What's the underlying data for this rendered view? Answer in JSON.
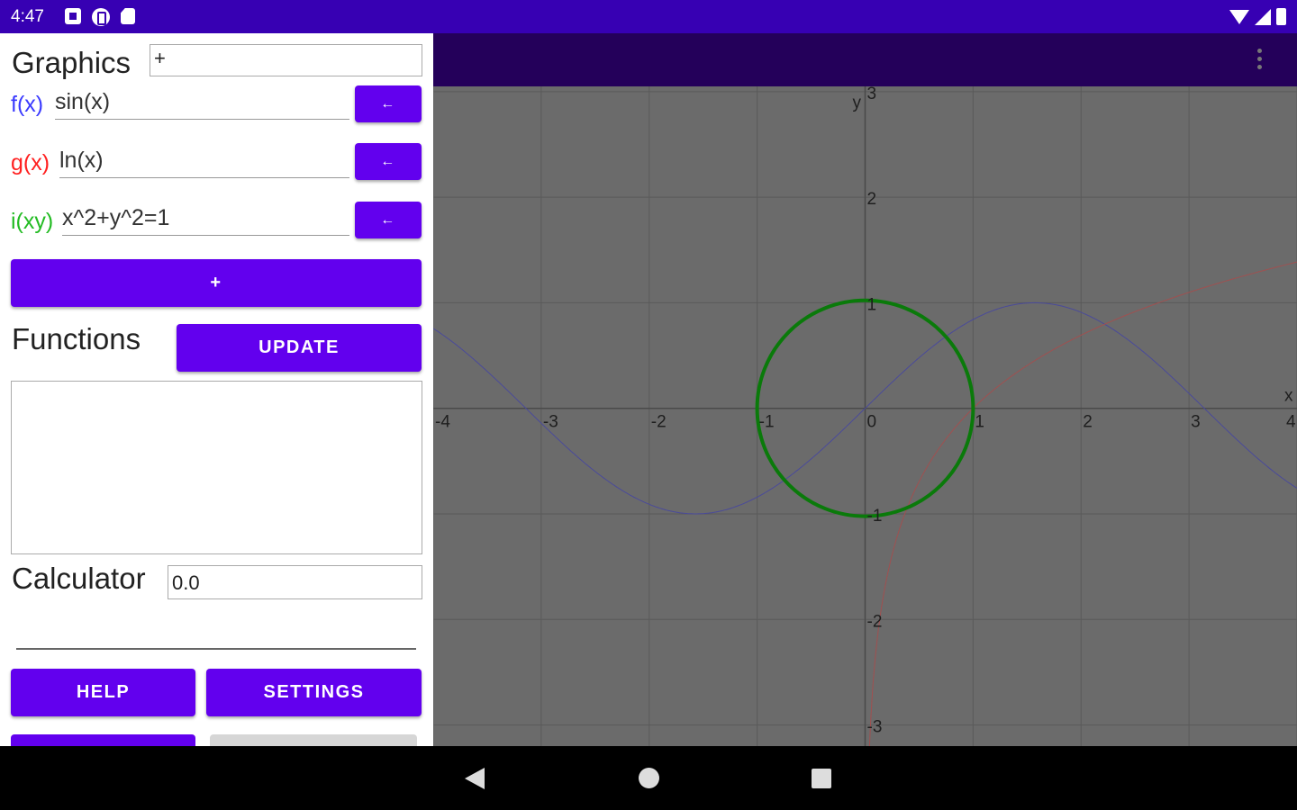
{
  "status_bar": {
    "time": "4:47"
  },
  "panel": {
    "graphics_label": "Graphics",
    "graphics_input_value": "+",
    "functions": [
      {
        "name": "f(x)",
        "expr": "sin(x)",
        "color": "#3b3bff",
        "button": "←"
      },
      {
        "name": "g(x)",
        "expr": "ln(x)",
        "color": "#ff2020",
        "button": "←"
      },
      {
        "name": "i(xy)",
        "expr": "x^2+y^2=1",
        "color": "#22bb22",
        "button": "←"
      }
    ],
    "add_button": "+",
    "functions_label": "Functions",
    "update_button": "UPDATE",
    "calculator_label": "Calculator",
    "calculator_value": "0.0",
    "help_button": "HELP",
    "settings_button": "SETTINGS"
  },
  "graph": {
    "x_axis_label": "x",
    "y_axis_label": "y",
    "x_ticks": [
      "-4",
      "-3",
      "-2",
      "-1",
      "0",
      "1",
      "2",
      "3",
      "4"
    ],
    "y_ticks": [
      "3",
      "2",
      "1",
      "-1",
      "-2",
      "-3"
    ],
    "xlim": [
      -4,
      4
    ],
    "ylim": [
      -3.2,
      3.05
    ],
    "grid": true,
    "colors": {
      "background": "#6b6b6b",
      "grid": "#5a5a5a",
      "axis": "#4a4a4a",
      "sin": "#4a4a9a",
      "ln": "#a05050",
      "circle": "#0a7a0a"
    }
  },
  "chart_data": {
    "type": "line",
    "xlim": [
      -4,
      4
    ],
    "ylim": [
      -3.2,
      3.05
    ],
    "grid": true,
    "xlabel": "x",
    "ylabel": "y",
    "series": [
      {
        "name": "sin(x)",
        "function": "sin",
        "domain": [
          -4,
          4
        ]
      },
      {
        "name": "ln(x)",
        "function": "ln",
        "domain": [
          0.04,
          4
        ]
      },
      {
        "name": "x^2+y^2=1",
        "function": "circle",
        "radius": 1
      }
    ]
  }
}
